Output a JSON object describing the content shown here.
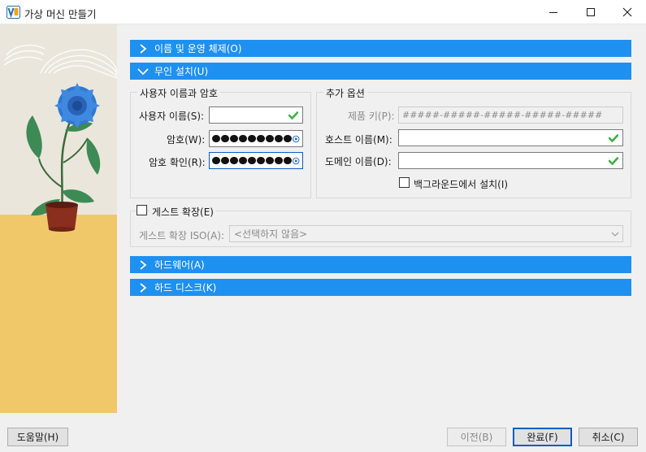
{
  "window": {
    "title": "가상 머신 만들기",
    "controls": [
      "minimize-icon",
      "maximize-icon",
      "close-icon"
    ]
  },
  "sections": {
    "name_os": {
      "label": "이름 및 운영 체제(O)",
      "expanded": false
    },
    "unattended": {
      "label": "무인 설치(U)",
      "expanded": true
    },
    "hardware": {
      "label": "하드웨어(A)",
      "expanded": false
    },
    "hard_disk": {
      "label": "하드 디스크(K)",
      "expanded": false
    }
  },
  "user_group": {
    "title": "사용자 이름과 암호",
    "username_label": "사용자 이름(S):",
    "username_value": "",
    "password_label": "암호(W):",
    "password_dots": 9,
    "confirm_label": "암호 확인(R):",
    "confirm_dots": 9
  },
  "extra_group": {
    "title": "추가 옵션",
    "product_key_label": "제품 키(P):",
    "product_key_placeholder": "#####-#####-#####-#####-#####",
    "hostname_label": "호스트 이름(M):",
    "hostname_value": "",
    "domain_label": "도메인 이름(D):",
    "domain_value": "",
    "background_install_label": "백그라운드에서 설치(I)",
    "background_install_checked": false
  },
  "guest_additions": {
    "label": "게스트 확장(E)",
    "checked": false,
    "iso_label": "게스트 확장 ISO(A):",
    "iso_value": "<선택하지 않음>"
  },
  "buttons": {
    "help": "도움말(H)",
    "back": "이전(B)",
    "finish": "완료(F)",
    "cancel": "취소(C)"
  },
  "colors": {
    "section_bar": "#1e90f0",
    "focus_border": "#0a5dc2",
    "check_ok": "#3cb043"
  }
}
